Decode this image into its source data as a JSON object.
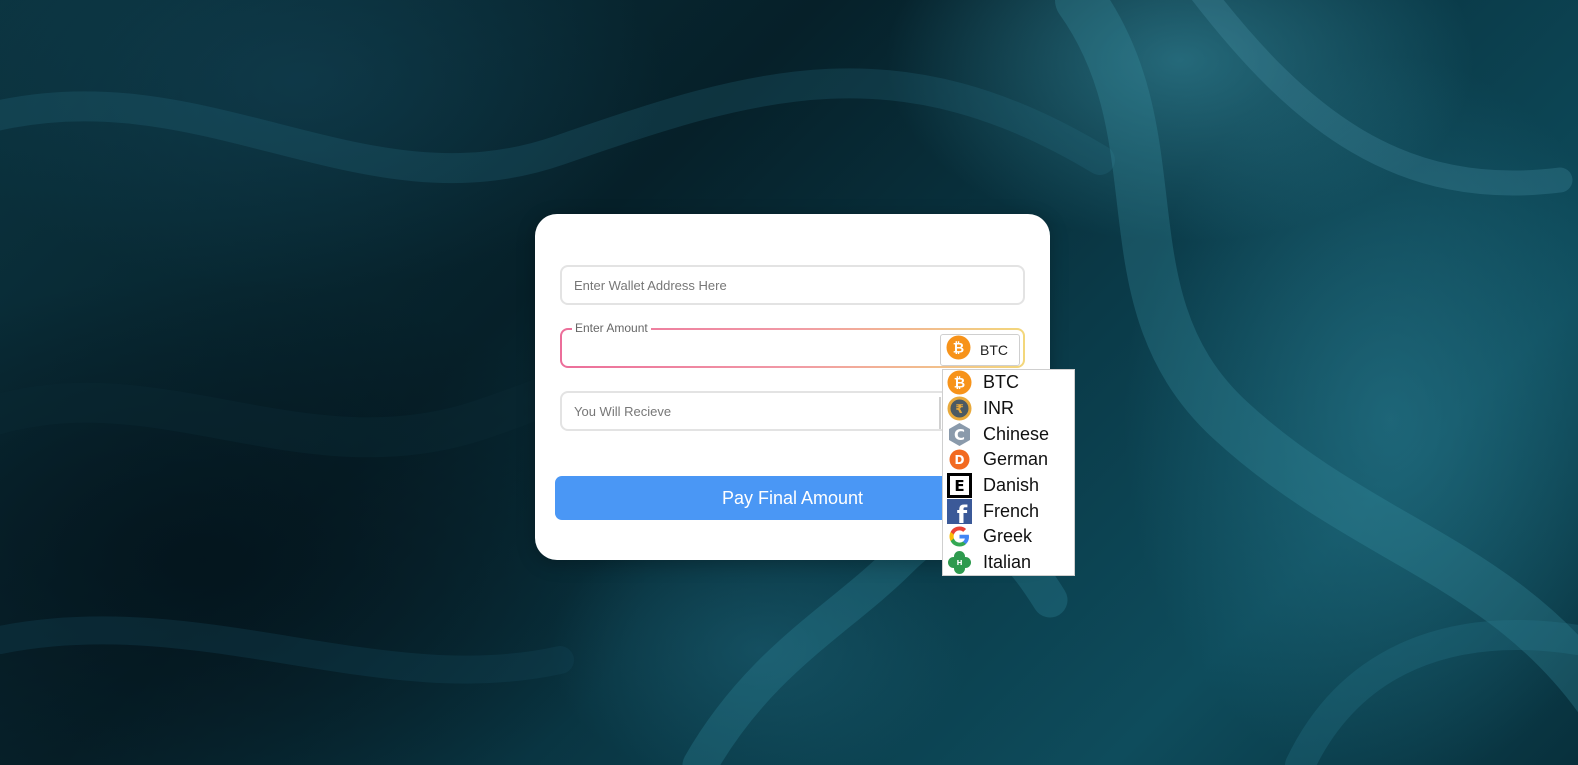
{
  "form": {
    "wallet_placeholder": "Enter Wallet Address Here",
    "amount_label": "Enter Amount",
    "amount_value": "",
    "receive_placeholder": "You Will Recieve",
    "selected_currency": "BTC",
    "pay_button_label": "Pay Final Amount"
  },
  "dropdown": {
    "options": [
      {
        "label": "BTC",
        "icon": "bitcoin-icon"
      },
      {
        "label": "INR",
        "icon": "rupee-coin-icon"
      },
      {
        "label": "Chinese",
        "icon": "hexagon-c-icon"
      },
      {
        "label": "German",
        "icon": "orange-d-icon"
      },
      {
        "label": "Danish",
        "icon": "boxed-e-icon"
      },
      {
        "label": "French",
        "icon": "facebook-icon"
      },
      {
        "label": "Greek",
        "icon": "google-icon"
      },
      {
        "label": "Italian",
        "icon": "clover-icon"
      }
    ]
  },
  "colors": {
    "button": "#4a97f5",
    "bitcoin": "#f7931a",
    "card": "#ffffff"
  }
}
